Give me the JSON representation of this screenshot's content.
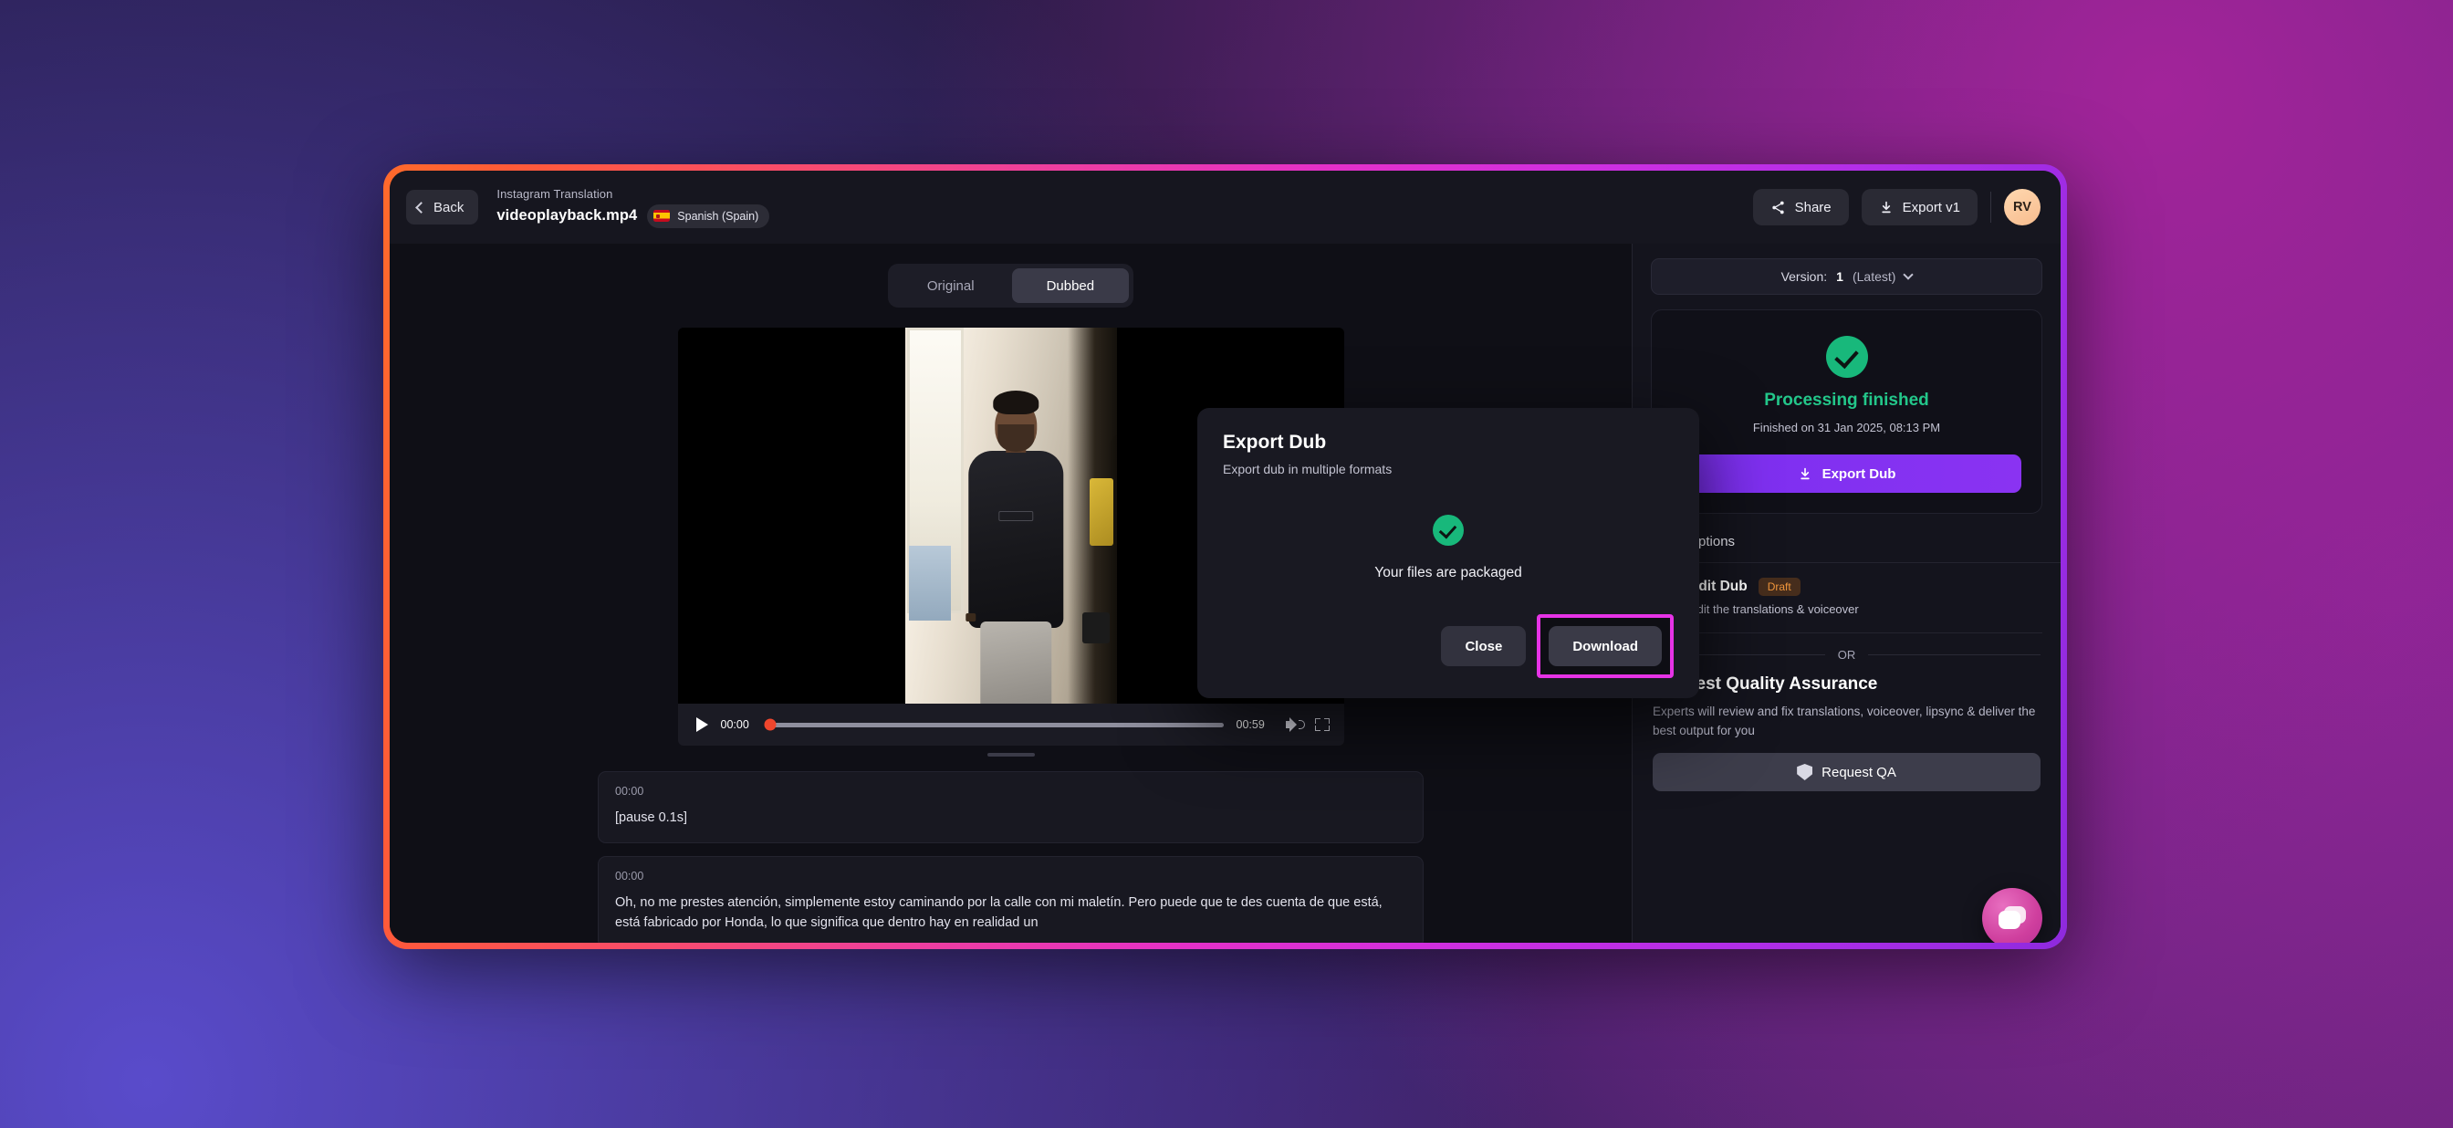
{
  "header": {
    "back_label": "Back",
    "breadcrumb": "Instagram Translation",
    "file_name": "videoplayback.mp4",
    "language": "Spanish (Spain)",
    "share_label": "Share",
    "export_label": "Export v1",
    "avatar_initials": "RV"
  },
  "tabs": [
    {
      "label": "Original",
      "active": false
    },
    {
      "label": "Dubbed",
      "active": true
    }
  ],
  "player": {
    "current_time": "00:00",
    "duration": "00:59",
    "progress_percent": 0
  },
  "transcript": [
    {
      "time": "00:00",
      "text": "[pause 0.1s]"
    },
    {
      "time": "00:00",
      "text": "Oh, no me prestes atención, simplemente estoy caminando por la calle con mi maletín. Pero puede que te des cuenta de que está, está fabricado por Honda, lo que significa que dentro hay en realidad un"
    }
  ],
  "sidebar": {
    "version_prefix": "Version:",
    "version_number": "1",
    "version_suffix": "(Latest)",
    "status_title": "Processing finished",
    "status_subtitle": "Finished on 31 Jan 2025, 08:13 PM",
    "export_dub_label": "Export Dub",
    "other_options_label": "Other options",
    "edit_dub": {
      "title": "Edit Dub",
      "badge": "Draft",
      "subtitle": "Edit the translations & voiceover"
    },
    "or_label": "OR",
    "qa": {
      "title": "Request Quality Assurance",
      "subtitle": "Experts will review and fix translations, voiceover, lipsync & deliver the best output for you",
      "button_label": "Request QA"
    }
  },
  "modal": {
    "title": "Export Dub",
    "subtitle": "Export dub in multiple formats",
    "message": "Your files are packaged",
    "close_label": "Close",
    "download_label": "Download"
  },
  "colors": {
    "accent_purple": "#7b2ff0",
    "success_green": "#23c78a",
    "highlight_magenta": "#e633e6",
    "draft_orange": "#f0963c",
    "scrub_red": "#f0462d"
  }
}
